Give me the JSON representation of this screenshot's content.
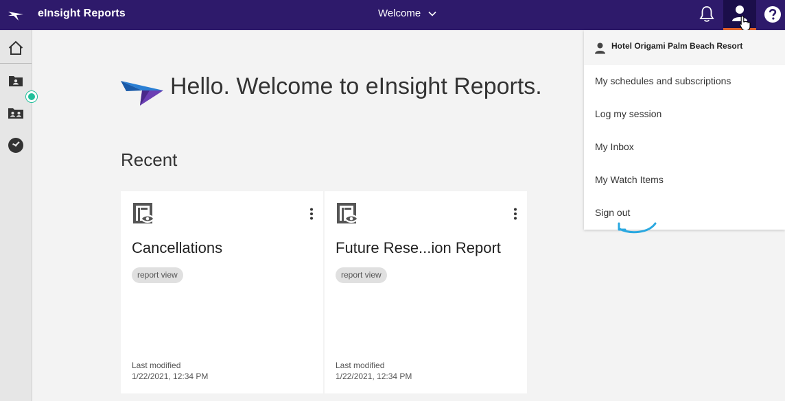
{
  "header": {
    "app_title": "eInsight Reports",
    "welcome_menu": "Welcome"
  },
  "hero": {
    "title": "Hello. Welcome to eInsight Reports."
  },
  "recent": {
    "heading": "Recent",
    "cards": [
      {
        "title": "Cancellations",
        "tag": "report view",
        "modified_label": "Last modified",
        "modified_date": "1/22/2021, 12:34 PM"
      },
      {
        "title": "Future Rese...ion Report",
        "tag": "report view",
        "modified_label": "Last modified",
        "modified_date": "1/22/2021, 12:34 PM"
      }
    ]
  },
  "user_menu": {
    "account_name": "Hotel Origami Palm Beach Resort",
    "items": [
      "My schedules and subscriptions",
      "Log my session",
      "My Inbox",
      "My Watch Items",
      "Sign out"
    ]
  },
  "colors": {
    "topbar": "#2e1a6b",
    "active_user_button": "#1b0e4a",
    "active_indicator": "#e8632a",
    "notification_dot": "#1fbf9a",
    "annotation_arrow": "#2aa8e0"
  },
  "icons": {
    "brand": "bird-logo-icon",
    "welcome_chevron": "chevron-down-icon",
    "notifications": "bell-icon",
    "user": "user-icon",
    "help": "help-icon",
    "rail": [
      "home-icon",
      "my-content-folder-icon",
      "team-content-folder-icon",
      "recent-clock-icon"
    ],
    "report_view": "report-view-icon",
    "card_menu": "kebab-menu-icon"
  }
}
